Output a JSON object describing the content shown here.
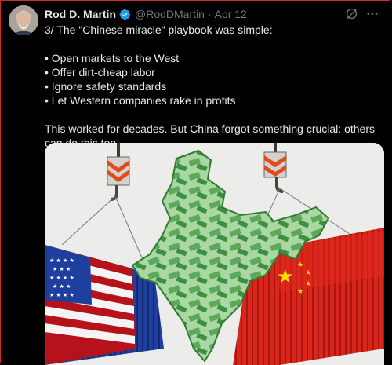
{
  "tweet": {
    "author_name": "Rod D. Martin",
    "handle": "@RodDMartin",
    "separator": "·",
    "date": "Apr 12",
    "lines": {
      "intro": "3/ The \"Chinese miracle\" playbook was simple:",
      "bullet_1": "• Open markets to the West",
      "bullet_2": "• Offer dirt-cheap labor",
      "bullet_3": "• Ignore safety standards",
      "bullet_4": "• Let Western companies rake in profits",
      "closing": "This worked for decades. But China forgot something crucial: others can do this too."
    }
  },
  "icons": {
    "verified": "verified-badge-icon",
    "grok": "grok-icon",
    "more": "more-options-icon"
  },
  "colors": {
    "background": "#000000",
    "text": "#e7e9ea",
    "muted": "#71767b",
    "verified_blue": "#1d9bf0",
    "frame_red": "#d02a2a"
  }
}
